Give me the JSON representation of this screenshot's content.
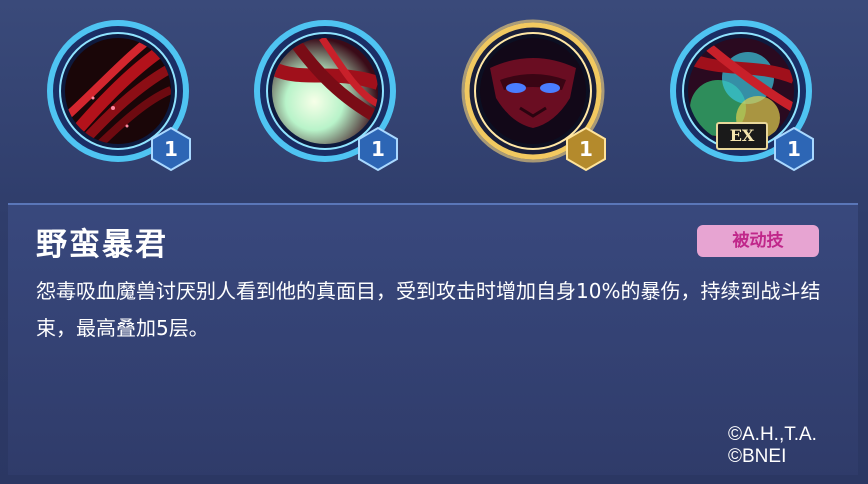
{
  "skills": [
    {
      "icon": "red-claw-icon",
      "level": "1",
      "selected": false
    },
    {
      "icon": "crimson-slash-icon",
      "level": "1",
      "selected": false
    },
    {
      "icon": "demon-mask-icon",
      "level": "1",
      "selected": true
    },
    {
      "icon": "ex-burst-icon",
      "level": "1",
      "selected": false,
      "ex_label": "EX"
    }
  ],
  "detail": {
    "title": "野蛮暴君",
    "tag": "被动技",
    "description": "怨毒吸血魔兽讨厌别人看到他的真面目，受到攻击时增加自身10%的暴伤，持续到战斗结束，最高叠加5层。"
  },
  "copyright": {
    "line1": "©A.H.,T.A.",
    "line2": "©BNEI"
  },
  "colors": {
    "ring_blue": "#4fc4f2",
    "ring_gold": "#f2c960",
    "badge_blue": "#2d66b5",
    "badge_gold": "#b48a2c",
    "tag_bg": "#e7a4d2",
    "tag_text": "#c0278a"
  }
}
